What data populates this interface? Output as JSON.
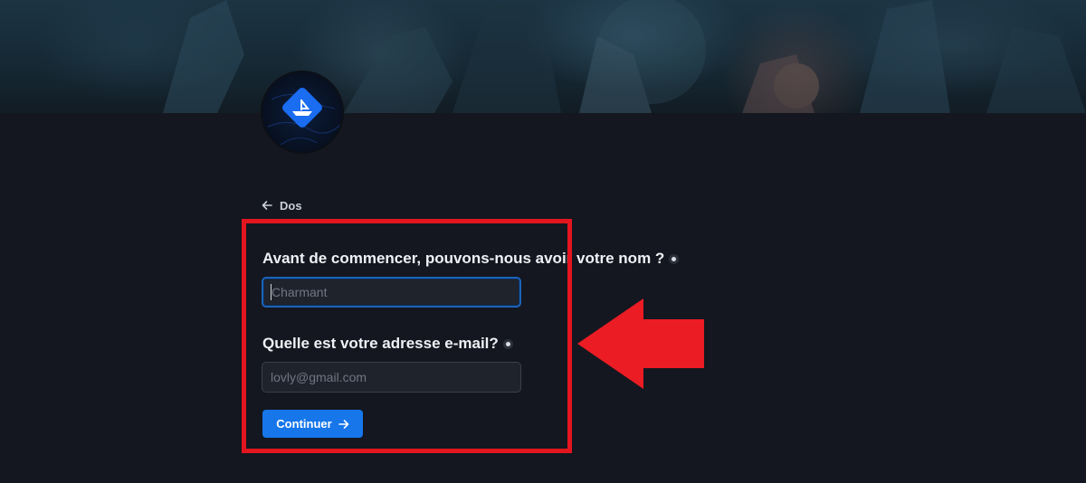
{
  "banner": {
    "icon": "game-characters-artwork"
  },
  "avatar": {
    "icon": "boat-logo-icon",
    "accent": "#1a6cf0"
  },
  "back": {
    "label": "Dos",
    "icon": "arrow-left-icon"
  },
  "form": {
    "name_question": "Avant de commencer, pouvons-nous avoir votre nom ?",
    "name_placeholder": "Charmant",
    "name_value": "",
    "email_question": "Quelle est votre adresse e-mail?",
    "email_placeholder": "lovly@gmail.com",
    "email_value": "",
    "required_icon": "required-dot-icon"
  },
  "continue_button": {
    "label": "Continuer",
    "icon": "arrow-right-icon",
    "color": "#1676ea"
  },
  "annotation": {
    "box_color": "#e3151e",
    "arrow_color": "#ec1c24",
    "arrow_icon": "arrow-left-icon"
  },
  "colors": {
    "background": "#14171f",
    "text": "#eef1f6",
    "input_bg": "#1f232c",
    "focus_border": "#1b63b9"
  }
}
